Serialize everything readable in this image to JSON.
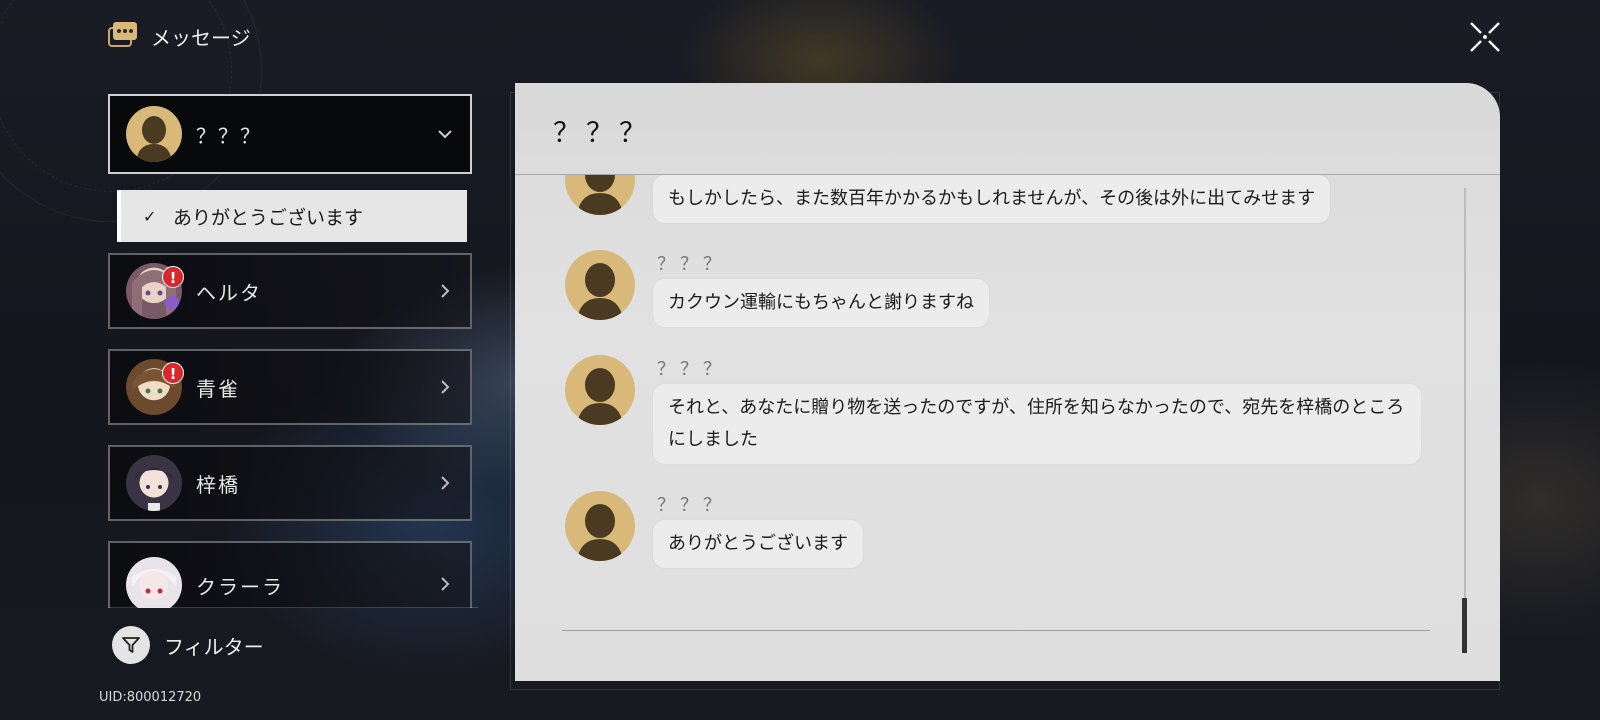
{
  "header": {
    "title": "メッセージ",
    "icon": "chat-bubble-icon"
  },
  "colors": {
    "accent_gold": "#d9b97a",
    "alert_red": "#d8282b",
    "panel_bg": "#dfdfdf"
  },
  "contacts": [
    {
      "name": "？？？",
      "active": true,
      "expanded": true,
      "alert": false,
      "avatar": "silhouette-avatar"
    },
    {
      "name": "ヘルタ",
      "active": false,
      "alert": true,
      "alert_mark": "!",
      "avatar": "herta-avatar"
    },
    {
      "name": "青雀",
      "active": false,
      "alert": true,
      "alert_mark": "!",
      "avatar": "qingque-avatar"
    },
    {
      "name": "梓橋",
      "active": false,
      "alert": false,
      "avatar": "zi-qiao-avatar"
    },
    {
      "name": "クラーラ",
      "active": false,
      "alert": false,
      "avatar": "clara-avatar"
    }
  ],
  "sub_item": {
    "check": "✓",
    "label": "ありがとうございます"
  },
  "filter": {
    "label": "フィルター"
  },
  "uid": "UID:800012720",
  "chat": {
    "title": "？？？",
    "messages": [
      {
        "sender": "？？？",
        "text": "もしかしたら、また数百年かかるかもしれませんが、その後は外に出てみせます"
      },
      {
        "sender": "？？？",
        "text": "カクウン運輸にもちゃんと謝りますね"
      },
      {
        "sender": "？？？",
        "text": "それと、あなたに贈り物を送ったのですが、住所を知らなかったので、宛先を梓橋のところにしました"
      },
      {
        "sender": "？？？",
        "text": "ありがとうございます"
      }
    ]
  }
}
